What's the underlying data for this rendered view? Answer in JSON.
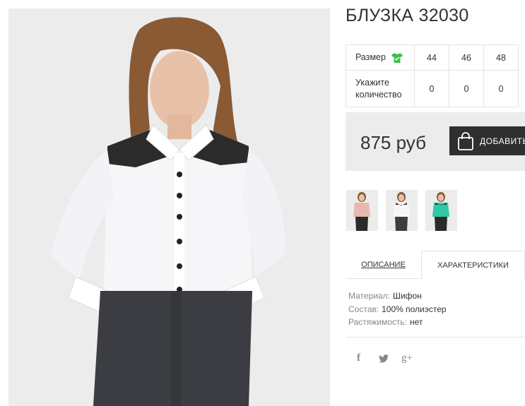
{
  "product": {
    "title": "БЛУЗКА 32030",
    "price": "875 руб",
    "add_to_cart_label": "ДОБАВИТЬ"
  },
  "sizes": {
    "size_label": "Размер",
    "qty_label": "Укажите количество",
    "values": [
      "44",
      "46",
      "48"
    ],
    "quantities": [
      "0",
      "0",
      "0"
    ]
  },
  "tabs": {
    "description": "ОПИСАНИЕ",
    "characteristics": "ХАРАКТЕРИСТИКИ"
  },
  "characteristics": [
    {
      "key": "Материал:",
      "value": "Шифон"
    },
    {
      "key": "Состав:",
      "value": "100% полиэстер"
    },
    {
      "key": "Растяжимость:",
      "value": "нет"
    }
  ],
  "social": {
    "facebook": "f",
    "twitter": "twitter-icon",
    "googleplus": "g+"
  },
  "thumbnails": [
    "pink-blouse-thumb",
    "white-blouse-thumb",
    "mint-blouse-thumb"
  ],
  "colors": {
    "accent_green": "#3cbf4a",
    "button_dark": "#2f2f2f",
    "panel_gray": "#ececec"
  }
}
